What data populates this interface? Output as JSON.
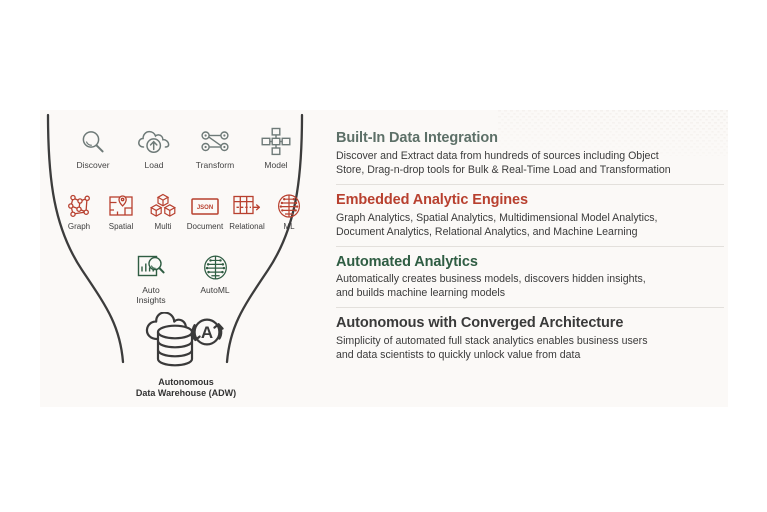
{
  "panel": {
    "background_color": "#fbf9f7"
  },
  "colors": {
    "slate_green": "#5d7068",
    "brick_red": "#b8402f",
    "forest_green": "#2f5d43",
    "charcoal": "#3a3a3a",
    "icon_gray": "#6e7a78",
    "funnel": "#3c3c3c"
  },
  "funnel": {
    "label": "data-funnel"
  },
  "ingest_row": {
    "name": "data-integration-icons",
    "items": [
      {
        "icon": "magnifier-icon",
        "label": "Discover"
      },
      {
        "icon": "cloud-upload-icon",
        "label": "Load"
      },
      {
        "icon": "node-graph-icon",
        "label": "Transform"
      },
      {
        "icon": "model-network-icon",
        "label": "Model"
      }
    ]
  },
  "engines_row": {
    "name": "analytic-engine-icons",
    "items": [
      {
        "icon": "molecule-icon",
        "label": "Graph"
      },
      {
        "icon": "map-pin-icon",
        "label": "Spatial"
      },
      {
        "icon": "cubes-icon",
        "label": "Multi"
      },
      {
        "icon": "json-document-icon",
        "label": "Document"
      },
      {
        "icon": "table-icon",
        "label": "Relational"
      },
      {
        "icon": "brain-icon",
        "label": "ML"
      }
    ]
  },
  "auto_row": {
    "name": "automated-analytics-icons",
    "items": [
      {
        "icon": "chart-magnifier-icon",
        "label": "Auto\nInsights"
      },
      {
        "icon": "brain-icon",
        "label": "AutoML"
      }
    ]
  },
  "adw": {
    "icon": "autonomous-data-warehouse-icon",
    "badge_letter": "A",
    "label": "Autonomous\nData Warehouse (ADW)"
  },
  "features": [
    {
      "id": "built-in-data-integration",
      "title": "Built-In Data Integration",
      "title_color": "#5d7068",
      "description": "Discover and Extract data from hundreds of sources including Object\nStore, Drag-n-drop tools for Bulk & Real-Time Load and Transformation"
    },
    {
      "id": "embedded-analytic-engines",
      "title": "Embedded Analytic Engines",
      "title_color": "#b8402f",
      "description": "Graph Analytics, Spatial Analytics, Multidimensional Model Analytics,\nDocument Analytics, Relational Analytics, and Machine Learning"
    },
    {
      "id": "automated-analytics",
      "title": "Automated Analytics",
      "title_color": "#2f5d43",
      "description": "Automatically creates business models, discovers hidden insights,\nand builds machine learning models"
    },
    {
      "id": "autonomous-with-converged-architecture",
      "title": "Autonomous with Converged Architecture",
      "title_color": "#3a3a3a",
      "description": "Simplicity of automated full stack analytics enables business users\nand data scientists to quickly unlock value from data"
    }
  ]
}
